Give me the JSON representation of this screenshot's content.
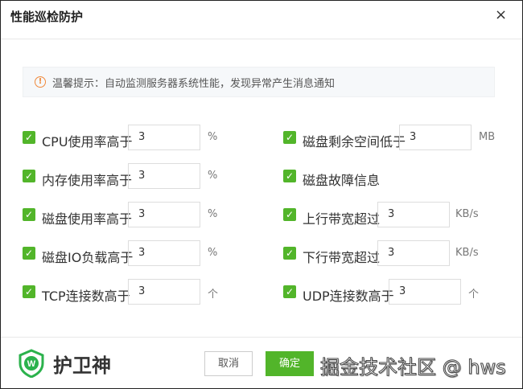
{
  "dialog": {
    "title": "性能巡检防护",
    "close": "×"
  },
  "notice": {
    "icon": "!",
    "text": "温馨提示：自动监测服务器系统性能，发现异常产生消息通知"
  },
  "left": [
    {
      "label": "CPU使用率高于",
      "value": "3",
      "unit": "%"
    },
    {
      "label": "内存使用率高于",
      "value": "3",
      "unit": "%"
    },
    {
      "label": "磁盘使用率高于",
      "value": "3",
      "unit": "%"
    },
    {
      "label": "磁盘IO负载高于",
      "value": "3",
      "unit": "%"
    },
    {
      "label": "TCP连接数高于",
      "value": "3",
      "unit": "个"
    }
  ],
  "right": [
    {
      "label": "磁盘剩余空间低于",
      "value": "3",
      "unit": "MB"
    },
    {
      "label": "磁盘故障信息"
    },
    {
      "label": "上行带宽超过",
      "value": "3",
      "unit": "KB/s"
    },
    {
      "label": "下行带宽超过",
      "value": "3",
      "unit": "KB/s"
    },
    {
      "label": "UDP连接数高于",
      "value": "3",
      "unit": "个"
    }
  ],
  "footer": {
    "brand": "护卫神",
    "cancel": "取消",
    "confirm": "确定",
    "watermark": "掘金技术社区 @ hws"
  },
  "colors": {
    "accent": "#52b52a",
    "warning": "#f0883a"
  }
}
